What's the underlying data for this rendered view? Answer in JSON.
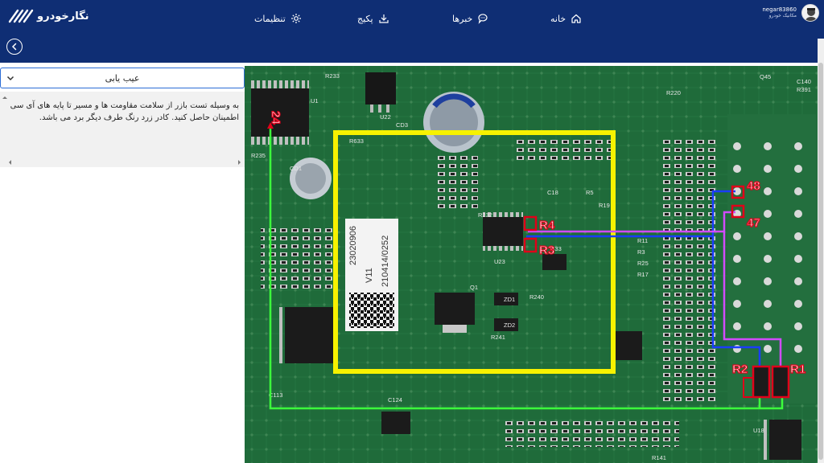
{
  "header": {
    "logo_text": "نگارخودرو",
    "nav": [
      {
        "label": "خانه",
        "icon": "home-icon"
      },
      {
        "label": "خبرها",
        "icon": "chat-icon"
      },
      {
        "label": "پکیج",
        "icon": "download-icon"
      },
      {
        "label": "تنظیمات",
        "icon": "gear-icon"
      }
    ],
    "user": {
      "name": "negar83860",
      "role": "مکانیک خودرو"
    }
  },
  "panel": {
    "dropdown_label": "عیب یابی",
    "description": "به وسیله تست بازر از سلامت مقاومت ها و مسیر تا پایه های آی سی اطمینان حاصل کنید. کادر زرد رنگ طرف دیگر برد می باشد."
  },
  "board": {
    "labels": {
      "r1": "R1",
      "r2": "R2",
      "r3": "R3",
      "r4": "R4",
      "pin47": "47",
      "pin48": "48",
      "pin24": "24",
      "chip_code1": "23020906",
      "chip_code2": "V11",
      "chip_code3": "210414/0252",
      "ref_r233": "R233",
      "ref_u22": "U22",
      "ref_cd3": "CD3",
      "ref_r633": "R633",
      "ref_r235": "R235",
      "ref_cd1": "CD1",
      "ref_u23": "U23",
      "ref_r232": "R232",
      "ref_u1": "U1",
      "ref_c113": "C113",
      "ref_c124": "C124",
      "ref_r141": "R141",
      "ref_q1": "Q1",
      "ref_zd1": "ZD1",
      "ref_zd2": "ZD2",
      "ref_r241": "R241",
      "ref_r240": "R240",
      "ref_r11": "R11",
      "ref_r3": "R3",
      "ref_r25": "R25",
      "ref_r17": "R17",
      "ref_u18": "U18",
      "ref_c140": "C140",
      "ref_r391": "R391",
      "ref_q45": "Q45",
      "ref_c18": "C18",
      "ref_r5": "R5",
      "ref_r220": "R220",
      "ref_r19": "R19",
      "ref_mark": "C33"
    },
    "colors": {
      "board": "#1f6b3a",
      "yellow_frame": "#f7f200",
      "green_trace": "#3cff3c",
      "blue_trace": "#1a3dff",
      "magenta_trace": "#d24bff",
      "red_box": "#e0001a"
    }
  }
}
